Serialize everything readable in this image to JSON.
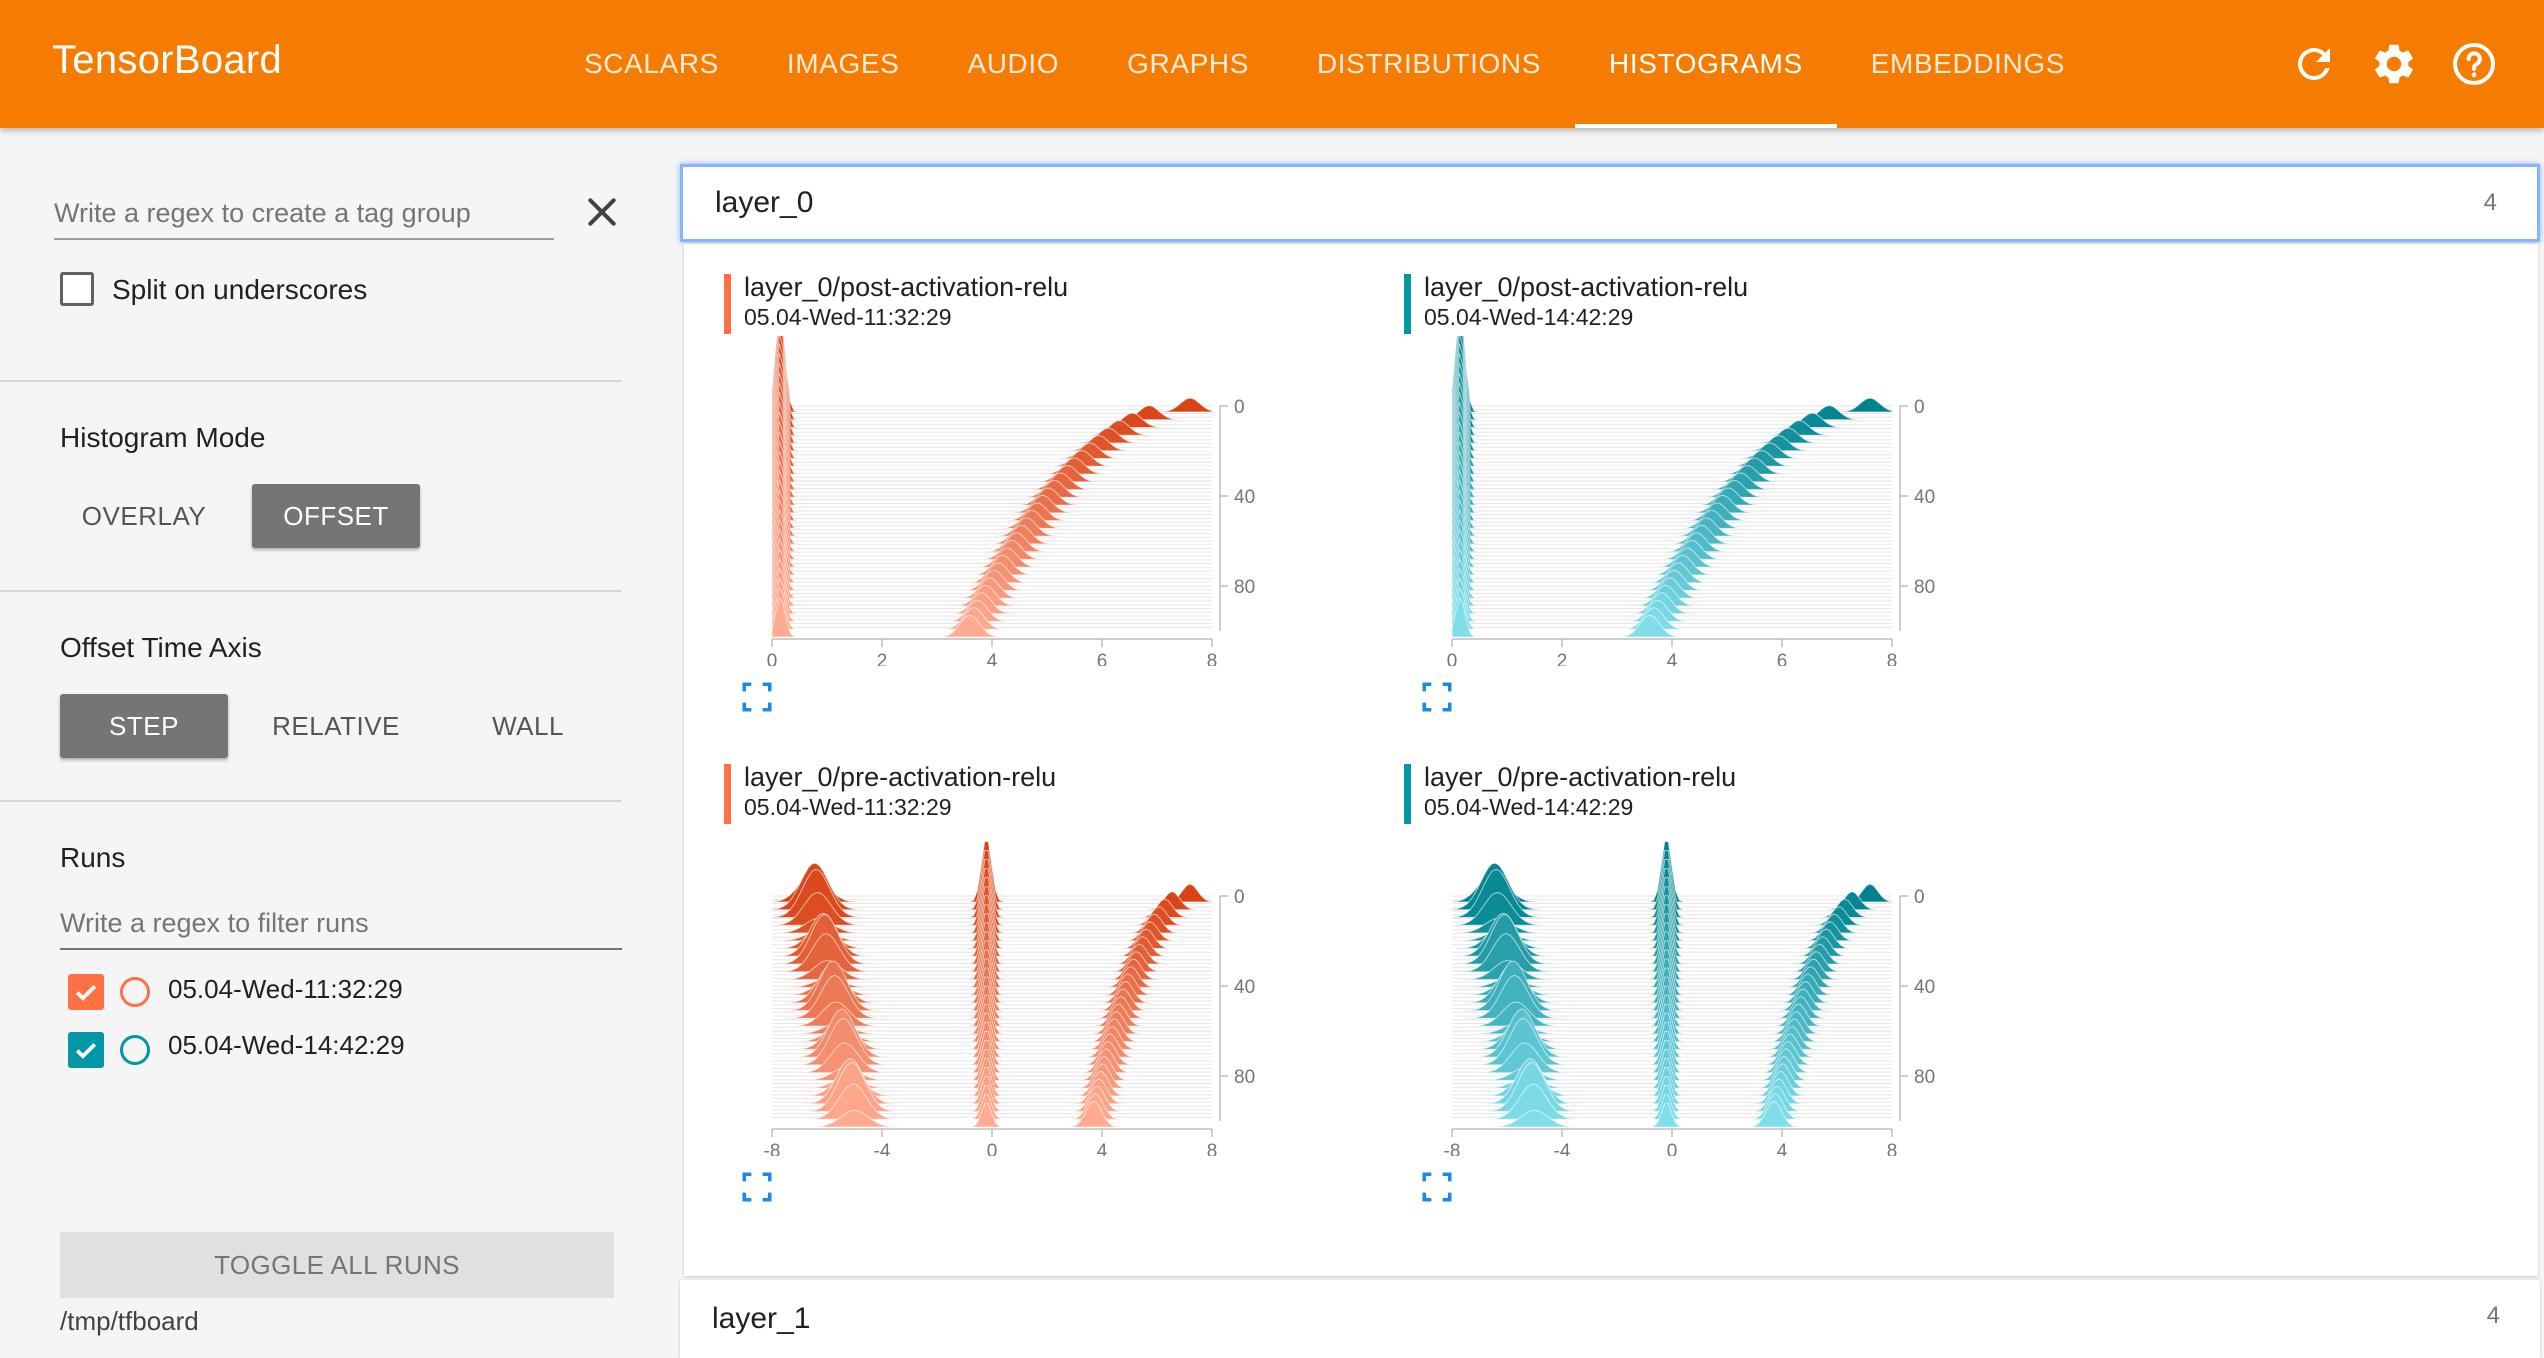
{
  "app": {
    "title": "TensorBoard"
  },
  "nav": {
    "tabs": [
      {
        "label": "SCALARS"
      },
      {
        "label": "IMAGES"
      },
      {
        "label": "AUDIO"
      },
      {
        "label": "GRAPHS"
      },
      {
        "label": "DISTRIBUTIONS"
      },
      {
        "label": "HISTOGRAMS"
      },
      {
        "label": "EMBEDDINGS"
      }
    ],
    "active_tab": "HISTOGRAMS"
  },
  "icons": {
    "reload": "refresh-icon",
    "settings": "gear-icon",
    "help": "help-icon",
    "clear": "close-icon",
    "expand": "fullscreen-icon"
  },
  "colors": {
    "header": "#f57c00",
    "run1": "#ff7043",
    "run2": "#0097a7",
    "selected_button": "#757575"
  },
  "sidebar": {
    "tag_regex_placeholder": "Write a regex to create a tag group",
    "split_label": "Split on underscores",
    "split_checked": false,
    "histogram_mode": {
      "title": "Histogram Mode",
      "options": [
        "OVERLAY",
        "OFFSET"
      ],
      "selected": "OFFSET"
    },
    "offset_time_axis": {
      "title": "Offset Time Axis",
      "options": [
        "STEP",
        "RELATIVE",
        "WALL"
      ],
      "selected": "STEP"
    },
    "runs": {
      "title": "Runs",
      "filter_placeholder": "Write a regex to filter runs",
      "items": [
        {
          "label": "05.04-Wed-11:32:29",
          "checked": true,
          "color": "#ff7043"
        },
        {
          "label": "05.04-Wed-14:42:29",
          "checked": true,
          "color": "#0097a7"
        }
      ]
    },
    "toggle_all_label": "TOGGLE ALL RUNS",
    "logdir": "/tmp/tfboard"
  },
  "groups": [
    {
      "name": "layer_0",
      "count": "4"
    },
    {
      "name": "layer_1",
      "count": "4"
    }
  ],
  "cards": [
    {
      "title": "layer_0/post-activation-relu",
      "run": "05.04-Wed-11:32:29",
      "color": "#ff7043"
    },
    {
      "title": "layer_0/post-activation-relu",
      "run": "05.04-Wed-14:42:29",
      "color": "#0097a7"
    },
    {
      "title": "layer_0/pre-activation-relu",
      "run": "05.04-Wed-11:32:29",
      "color": "#ff7043"
    },
    {
      "title": "layer_0/pre-activation-relu",
      "run": "05.04-Wed-14:42:29",
      "color": "#0097a7"
    }
  ],
  "chart_data": [
    {
      "type": "area",
      "title": "layer_0/post-activation-relu",
      "series": [
        {
          "name": "05.04-Wed-11:32:29"
        }
      ],
      "x_ticks": [
        "0",
        "2",
        "4",
        "6",
        "8"
      ],
      "y_ticks": [
        "0",
        "40",
        "80"
      ],
      "xlim": [
        0,
        8
      ],
      "ylim": [
        0,
        100
      ]
    },
    {
      "type": "area",
      "title": "layer_0/post-activation-relu",
      "series": [
        {
          "name": "05.04-Wed-14:42:29"
        }
      ],
      "x_ticks": [
        "0",
        "2",
        "4",
        "6",
        "8"
      ],
      "y_ticks": [
        "0",
        "40",
        "80"
      ],
      "xlim": [
        0,
        8
      ],
      "ylim": [
        0,
        100
      ]
    },
    {
      "type": "area",
      "title": "layer_0/pre-activation-relu",
      "series": [
        {
          "name": "05.04-Wed-11:32:29"
        }
      ],
      "x_ticks": [
        "-8",
        "-4",
        "0",
        "4",
        "8"
      ],
      "y_ticks": [
        "0",
        "40",
        "80"
      ],
      "xlim": [
        -8,
        8
      ],
      "ylim": [
        0,
        100
      ]
    },
    {
      "type": "area",
      "title": "layer_0/pre-activation-relu",
      "series": [
        {
          "name": "05.04-Wed-14:42:29"
        }
      ],
      "x_ticks": [
        "-8",
        "-4",
        "0",
        "4",
        "8"
      ],
      "y_ticks": [
        "0",
        "40",
        "80"
      ],
      "xlim": [
        -8,
        8
      ],
      "ylim": [
        0,
        100
      ]
    }
  ]
}
